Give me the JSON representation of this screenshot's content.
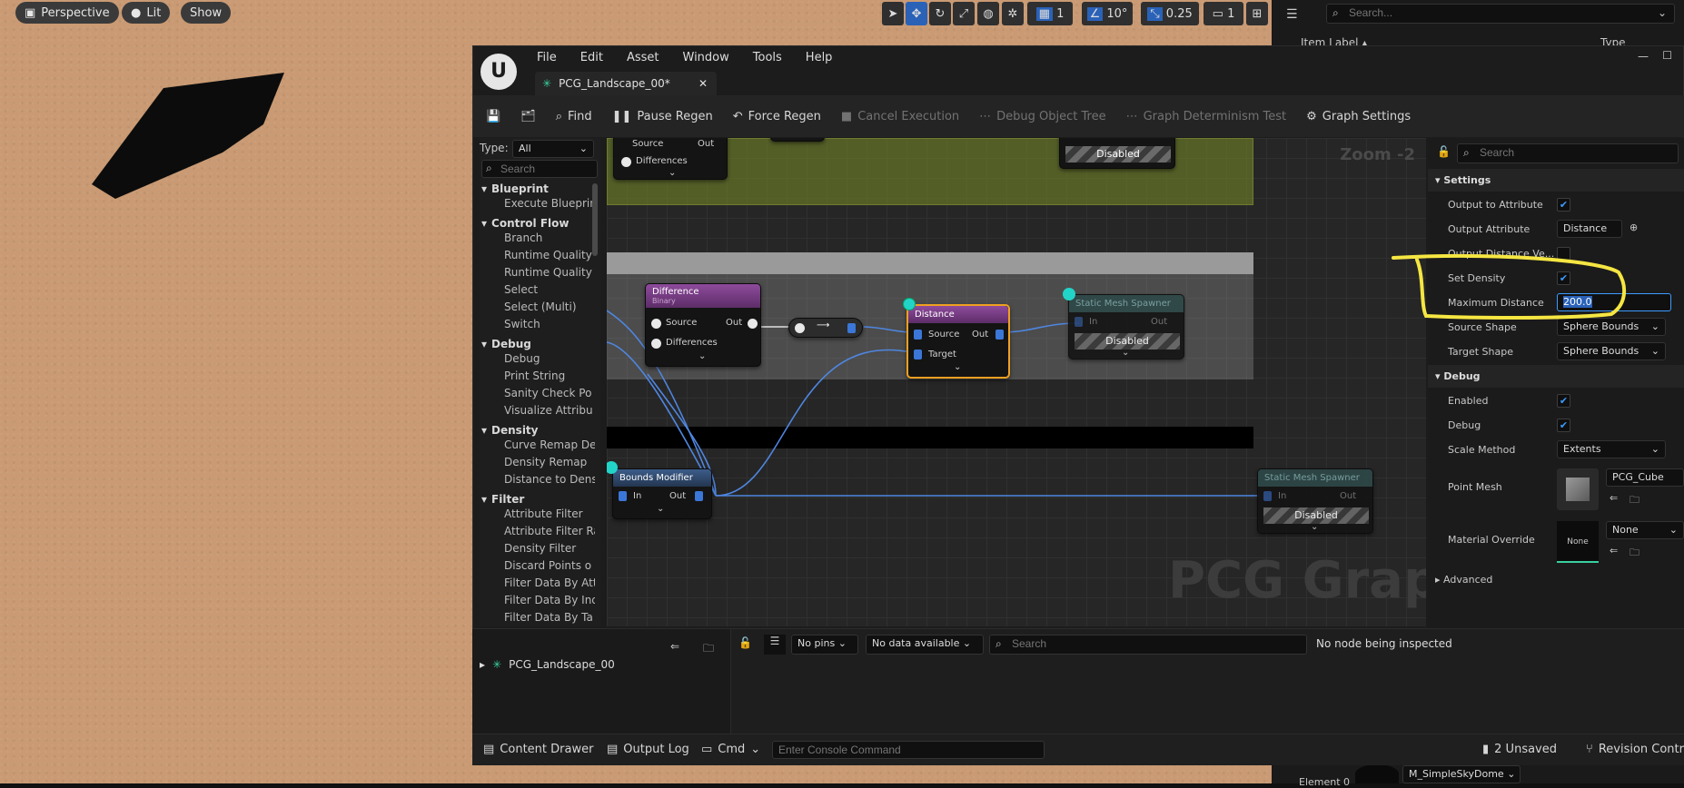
{
  "viewport": {
    "perspective": "Perspective",
    "lit": "Lit",
    "show": "Show",
    "grid_val": "1",
    "angle_val": "10°",
    "scale_val": "0.25",
    "cam_val": "1"
  },
  "outliner": {
    "search_placeholder": "Search...",
    "col_label": "Item Label ▴",
    "col_type": "Type",
    "element": "Element 0",
    "sky": "M_SimpleSkyDome"
  },
  "menu": [
    "File",
    "Edit",
    "Asset",
    "Window",
    "Tools",
    "Help"
  ],
  "tab": {
    "title": "PCG_Landscape_00*"
  },
  "toolbar": {
    "find": "Find",
    "pause": "Pause Regen",
    "force": "Force Regen",
    "cancel": "Cancel Execution",
    "debug_tree": "Debug Object Tree",
    "determinism": "Graph Determinism Test",
    "settings": "Graph Settings"
  },
  "palette": {
    "type_label": "Type:",
    "type_value": "All",
    "search_placeholder": "Search",
    "cats": [
      {
        "name": "Blueprint",
        "items": [
          "Execute Blueprint"
        ]
      },
      {
        "name": "Control Flow",
        "items": [
          "Branch",
          "Runtime Quality",
          "Runtime Quality",
          "Select",
          "Select (Multi)",
          "Switch"
        ]
      },
      {
        "name": "Debug",
        "items": [
          "Debug",
          "Print String",
          "Sanity Check Po",
          "Visualize Attribu"
        ]
      },
      {
        "name": "Density",
        "items": [
          "Curve Remap De",
          "Density Remap",
          "Distance to Dens"
        ]
      },
      {
        "name": "Filter",
        "items": [
          "Attribute Filter",
          "Attribute Filter Ra",
          "Density Filter",
          "Discard Points o",
          "Filter Data By Att",
          "Filter Data By Ind",
          "Filter Data By Ta"
        ]
      }
    ]
  },
  "graph": {
    "zoom": "Zoom -2",
    "watermark": "PCG Graph",
    "top_node": {
      "source": "Source",
      "out": "Out",
      "differences": "Differences"
    },
    "top_disabled": "Disabled",
    "diff_node": {
      "title": "Difference",
      "subtitle": "Binary",
      "source": "Source",
      "out": "Out",
      "differences": "Differences"
    },
    "dist_node": {
      "title": "Distance",
      "source": "Source",
      "out": "Out",
      "target": "Target"
    },
    "sms1": {
      "title": "Static Mesh Spawner",
      "in": "In",
      "out": "Out",
      "disabled": "Disabled"
    },
    "bounds": {
      "title": "Bounds Modifier",
      "in": "In",
      "out": "Out"
    },
    "sms2": {
      "title": "Static Mesh Spawner",
      "in": "In",
      "out": "Out",
      "disabled": "Disabled"
    }
  },
  "details": {
    "search_placeholder": "Search",
    "settings": "Settings",
    "output_to_attr": "Output to Attribute",
    "output_attr": "Output Attribute",
    "output_attr_val": "Distance",
    "output_dist_vec": "Output Distance Ve...",
    "set_density": "Set Density",
    "max_dist": "Maximum Distance",
    "max_dist_val": "200.0",
    "source_shape": "Source Shape",
    "source_shape_val": "Sphere Bounds",
    "target_shape": "Target Shape",
    "target_shape_val": "Sphere Bounds",
    "debug": "Debug",
    "enabled": "Enabled",
    "debug_row": "Debug",
    "scale_method": "Scale Method",
    "scale_method_val": "Extents",
    "point_mesh": "Point Mesh",
    "point_mesh_val": "PCG_Cube",
    "material_override": "Material Override",
    "material_val": "None",
    "material_thumb": "None",
    "advanced": "Advanced"
  },
  "bottom": {
    "tree_item": "PCG_Landscape_00",
    "pins": "No pins",
    "data": "No data available",
    "search_placeholder": "Search",
    "inspect": "No node being inspected"
  },
  "status": {
    "content": "Content Drawer",
    "output": "Output Log",
    "cmd": "Cmd",
    "console_placeholder": "Enter Console Command",
    "unsaved": "2 Unsaved",
    "revision": "Revision Contr"
  },
  "colors": {
    "accent": "#3d9bff",
    "highlight": "#f5e642",
    "diff_header": "#7a3f86",
    "dist_border": "#f0a020"
  }
}
